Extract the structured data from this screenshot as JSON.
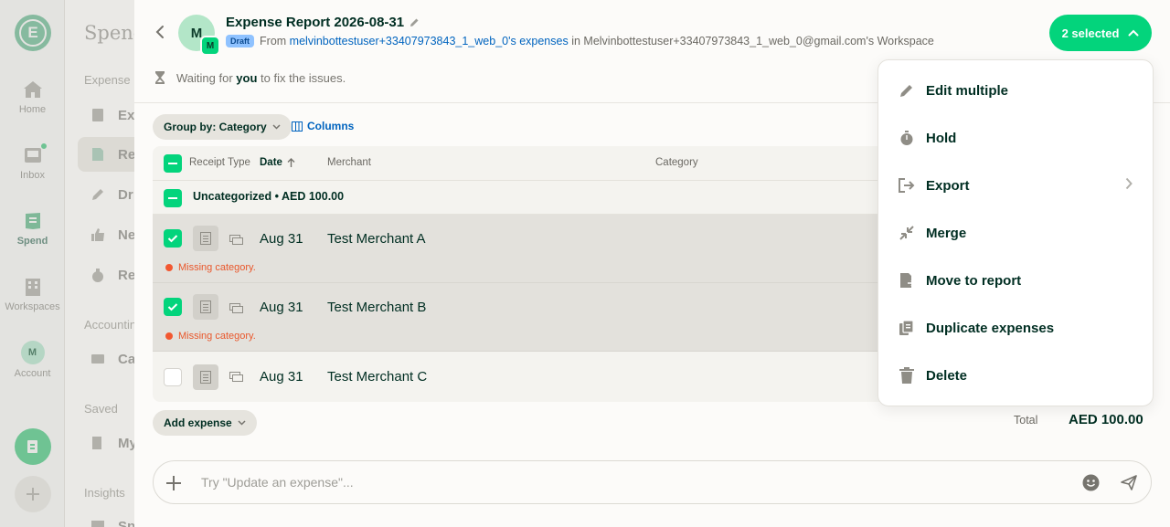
{
  "nav_rail": {
    "items": [
      {
        "label": "Home",
        "icon": "home-icon"
      },
      {
        "label": "Inbox",
        "icon": "inbox-icon"
      },
      {
        "label": "Spend",
        "icon": "spend-icon"
      },
      {
        "label": "Workspaces",
        "icon": "building-icon"
      },
      {
        "label": "Account",
        "icon": "avatar"
      }
    ],
    "account_initial": "M"
  },
  "sidebar": {
    "title": "Spend",
    "sections": [
      "Expense r",
      "Accountin",
      "Saved",
      "Insights"
    ],
    "items": [
      "Ex",
      "Re",
      "Dr",
      "Ne",
      "Re",
      "Ca",
      "My",
      "Sp"
    ]
  },
  "header": {
    "avatar_initial": "M",
    "workspace_initial": "M",
    "title": "Expense Report 2026-08-31",
    "badge": "Draft",
    "from_prefix": "From",
    "from_link": "melvinbottestuser+33407973843_1_web_0's expenses",
    "in_text": "in Melvinbottestuser+33407973843_1_web_0@gmail.com's Workspace",
    "selected_label": "2 selected"
  },
  "status": {
    "prefix": "Waiting for",
    "who": "you",
    "suffix": "to fix the issues."
  },
  "toolbar": {
    "group_by_label": "Group by: Category",
    "columns_label": "Columns"
  },
  "table": {
    "headers": {
      "receipt_type": "Receipt Type",
      "date": "Date",
      "merchant": "Merchant",
      "category": "Category"
    },
    "group_label": "Uncategorized • AED 100.00",
    "rows": [
      {
        "date": "Aug 31",
        "merchant": "Test Merchant A",
        "error": "Missing category.",
        "selected": true
      },
      {
        "date": "Aug 31",
        "merchant": "Test Merchant B",
        "error": "Missing category.",
        "selected": true
      },
      {
        "date": "Aug 31",
        "merchant": "Test Merchant C",
        "error": "",
        "selected": false
      }
    ]
  },
  "footer": {
    "add_expense_label": "Add expense",
    "total_label": "Total",
    "total_value": "AED 100.00"
  },
  "composer": {
    "placeholder": "Try \"Update an expense\"..."
  },
  "popover": {
    "items": [
      {
        "label": "Edit multiple",
        "icon": "pencil-icon"
      },
      {
        "label": "Hold",
        "icon": "stopwatch-icon"
      },
      {
        "label": "Export",
        "icon": "export-icon",
        "has_submenu": true
      },
      {
        "label": "Merge",
        "icon": "merge-icon"
      },
      {
        "label": "Move to report",
        "icon": "move-report-icon"
      },
      {
        "label": "Duplicate expenses",
        "icon": "duplicate-icon"
      },
      {
        "label": "Delete",
        "icon": "trash-icon"
      }
    ]
  },
  "colors": {
    "accent_green": "#03d47c",
    "link_blue": "#0164bf",
    "error_red": "#e9572b",
    "text_dark": "#002e22"
  }
}
